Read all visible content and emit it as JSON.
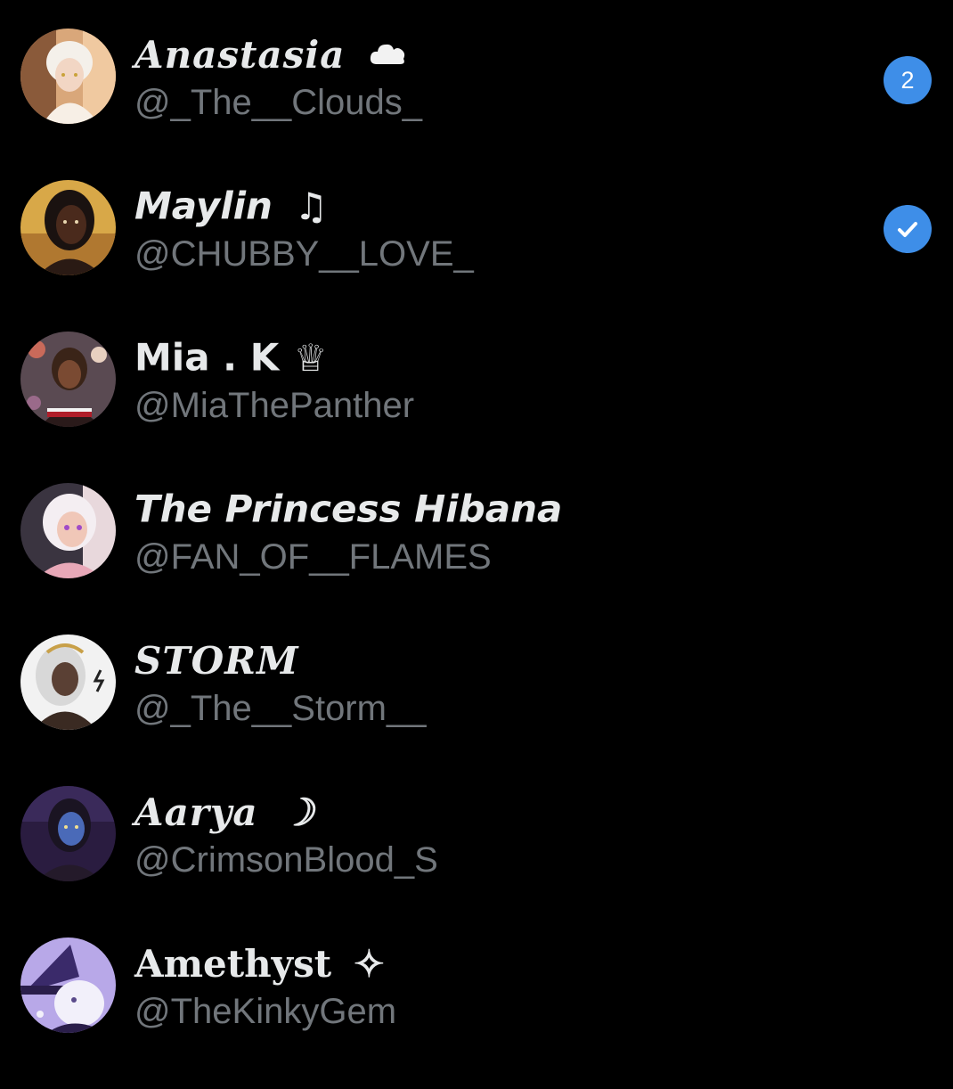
{
  "colors": {
    "background": "#000000",
    "name": "#e7e9ea",
    "handle": "#71767b",
    "accent": "#3e8ee8"
  },
  "accounts": [
    {
      "display_name": "Anastasia",
      "emoji": "cloud-icon",
      "handle": "@_The__Clouds_",
      "badge_count": "2",
      "active": false
    },
    {
      "display_name": "Maylin",
      "emoji": "♫",
      "handle": "@CHUBBY__LOVE_",
      "active": true
    },
    {
      "display_name": "Mia . K",
      "emoji": "♕",
      "handle": "@MiaThePanther",
      "active": false
    },
    {
      "display_name": "The Princess Hibana",
      "handle": "@FAN_OF__FLAMES",
      "active": false
    },
    {
      "display_name": "STORM",
      "handle": "@_The__Storm__",
      "active": false
    },
    {
      "display_name": "Aarya",
      "emoji": "☽",
      "handle": "@CrimsonBlood_S",
      "active": false
    },
    {
      "display_name": "Amethyst",
      "emoji": "✧",
      "handle": "@TheKinkyGem",
      "active": false
    }
  ]
}
